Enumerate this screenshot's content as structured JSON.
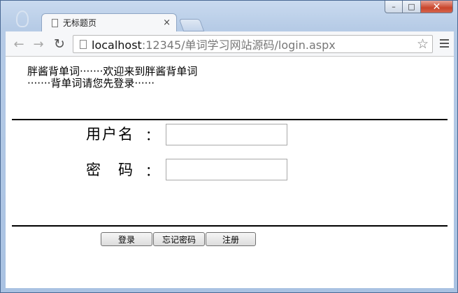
{
  "browser": {
    "tab_title": "无标题页",
    "tab_close": "×",
    "url_host": "localhost",
    "url_rest": ":12345/单词学习网站源码/login.aspx",
    "star": "☆",
    "back": "←",
    "forward": "→",
    "reload": "↻",
    "win_min": "–",
    "win_max": "□",
    "win_close": "✕"
  },
  "page": {
    "welcome_line1": "胖酱背单词·······欢迎来到胖酱背单词",
    "welcome_line2": "·······背单词请您先登录······",
    "username_label": "用户名",
    "password_label": "密　码",
    "colon": "：",
    "username_value": "",
    "password_value": "",
    "buttons": {
      "login": "登录",
      "forgot": "忘记密码",
      "register": "注册"
    }
  }
}
